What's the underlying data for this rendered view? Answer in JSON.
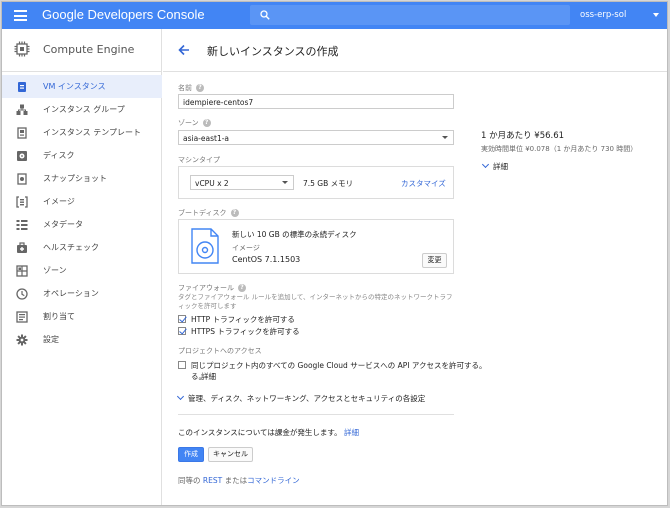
{
  "header": {
    "brand": "Google Developers Console",
    "project": "oss-erp-sol"
  },
  "sidebar": {
    "title": "Compute Engine",
    "items": [
      {
        "label": "VM インスタンス",
        "icon": "vm-instance-icon",
        "active": true
      },
      {
        "label": "インスタンス グループ",
        "icon": "instance-group-icon"
      },
      {
        "label": "インスタンス テンプレート",
        "icon": "instance-template-icon"
      },
      {
        "label": "ディスク",
        "icon": "disk-icon"
      },
      {
        "label": "スナップショット",
        "icon": "snapshot-icon"
      },
      {
        "label": "イメージ",
        "icon": "image-icon"
      },
      {
        "label": "メタデータ",
        "icon": "metadata-icon"
      },
      {
        "label": "ヘルスチェック",
        "icon": "health-check-icon"
      },
      {
        "label": "ゾーン",
        "icon": "zone-icon"
      },
      {
        "label": "オペレーション",
        "icon": "operations-icon"
      },
      {
        "label": "割り当て",
        "icon": "quota-icon"
      },
      {
        "label": "設定",
        "icon": "settings-icon"
      }
    ]
  },
  "page": {
    "title": "新しいインスタンスの作成"
  },
  "form": {
    "name_label": "名前",
    "name_value": "idempiere-centos7",
    "zone_label": "ゾーン",
    "zone_value": "asia-east1-a",
    "machine_type_label": "マシンタイプ",
    "machine_type_value": "vCPU x 2",
    "machine_memory": "7.5 GB メモリ",
    "customize_link": "カスタマイズ",
    "boot_disk_label": "ブートディスク",
    "boot_disk_title": "新しい 10 GB の標準の永続ディスク",
    "boot_disk_type": "イメージ",
    "boot_disk_os": "CentOS 7.1.1503",
    "change_button": "変更",
    "firewall_label": "ファイアウォール",
    "firewall_desc": "タグとファイアウォール ルールを追加して、インターネットからの特定のネットワークトラフィックを許可します",
    "http_label": "HTTP トラフィックを許可する",
    "http_checked": true,
    "https_label": "HTTPS トラフィックを許可する",
    "https_checked": true,
    "project_access_label": "プロジェクトへのアクセス",
    "api_access_label": "同じプロジェクト内のすべての Google Cloud サービスへの API アクセスを許可する。",
    "api_access_link": "詳細",
    "api_access_checked": false,
    "advanced_link": "管理、ディスク、ネットワーキング、アクセスとセキュリティの各設定",
    "billing_text": "このインスタンスについては課金が発生します。",
    "billing_link": "詳細",
    "create_button": "作成",
    "cancel_button": "キャンセル",
    "equivalent_prefix": "同等の",
    "rest_link": "REST",
    "or_text": "または",
    "cli_link": "コマンドライン"
  },
  "pricing": {
    "monthly": "1 か月あたり ¥56.61",
    "effective": "実効時間単位 ¥0.078（1 か月あたり 730 時間）",
    "details_link": "詳細"
  }
}
